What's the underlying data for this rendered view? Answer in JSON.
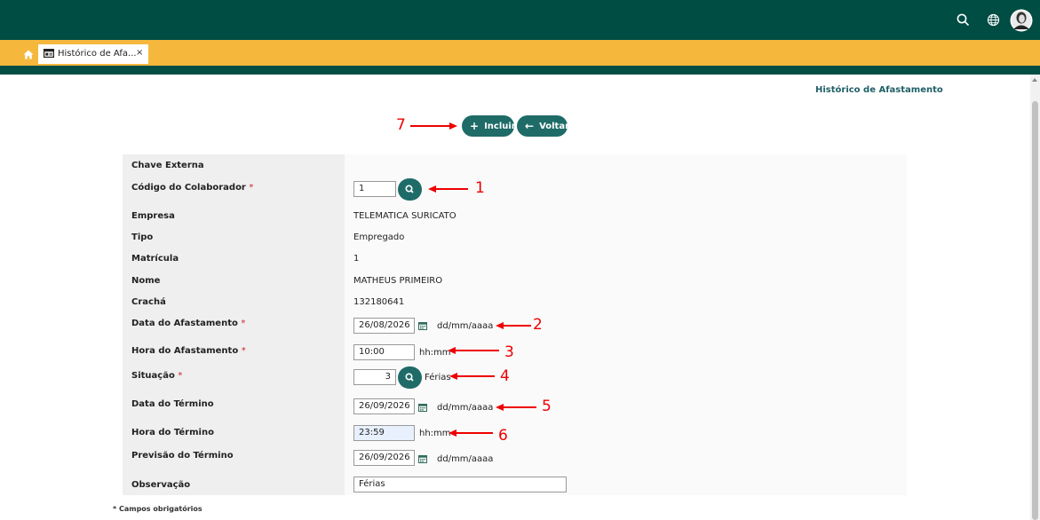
{
  "breadcrumb": {
    "current": "Histórico de Afastamento"
  },
  "tab": {
    "label": "Histórico de Afa...",
    "close": "×"
  },
  "toolbar": {
    "incluir_label": "Incluir",
    "voltar_label": "Voltar"
  },
  "form": {
    "chave_externa": {
      "label": "Chave Externa"
    },
    "codigo_colaborador": {
      "label": "Código do Colaborador",
      "required": "*",
      "value": "1"
    },
    "empresa": {
      "label": "Empresa",
      "value": "TELEMATICA SURICATO"
    },
    "tipo": {
      "label": "Tipo",
      "value": "Empregado"
    },
    "matricula": {
      "label": "Matrícula",
      "value": "1"
    },
    "nome": {
      "label": "Nome",
      "value": "MATHEUS PRIMEIRO"
    },
    "cracha": {
      "label": "Crachá",
      "value": "132180641"
    },
    "data_afastamento": {
      "label": "Data do Afastamento",
      "required": "*",
      "value": "26/08/2026",
      "hint": "dd/mm/aaaa"
    },
    "hora_afastamento": {
      "label": "Hora do Afastamento",
      "required": "*",
      "value": "10:00",
      "hint": "hh:mm"
    },
    "situacao": {
      "label": "Situação",
      "required": "*",
      "value": "3",
      "desc": "Férias"
    },
    "data_termino": {
      "label": "Data do Término",
      "value": "26/09/2026",
      "hint": "dd/mm/aaaa"
    },
    "hora_termino": {
      "label": "Hora do Término",
      "value": "23:59",
      "hint": "hh:mm"
    },
    "previsao_termino": {
      "label": "Previsão do Término",
      "value": "26/09/2026",
      "hint": "dd/mm/aaaa"
    },
    "observacao": {
      "label": "Observação",
      "value": "Férias"
    }
  },
  "footnote": "* Campos obrigatórios",
  "annotations": [
    "1",
    "2",
    "3",
    "4",
    "5",
    "6",
    "7"
  ],
  "colors": {
    "header": "#004d44",
    "tabbar": "#f5b83d",
    "button": "#1f6b68",
    "annotation": "#e00000"
  },
  "icons": [
    "search-icon",
    "globe-icon",
    "avatar",
    "home-icon",
    "window-icon",
    "plus-icon",
    "arrow-left-icon",
    "calendar-icon"
  ]
}
